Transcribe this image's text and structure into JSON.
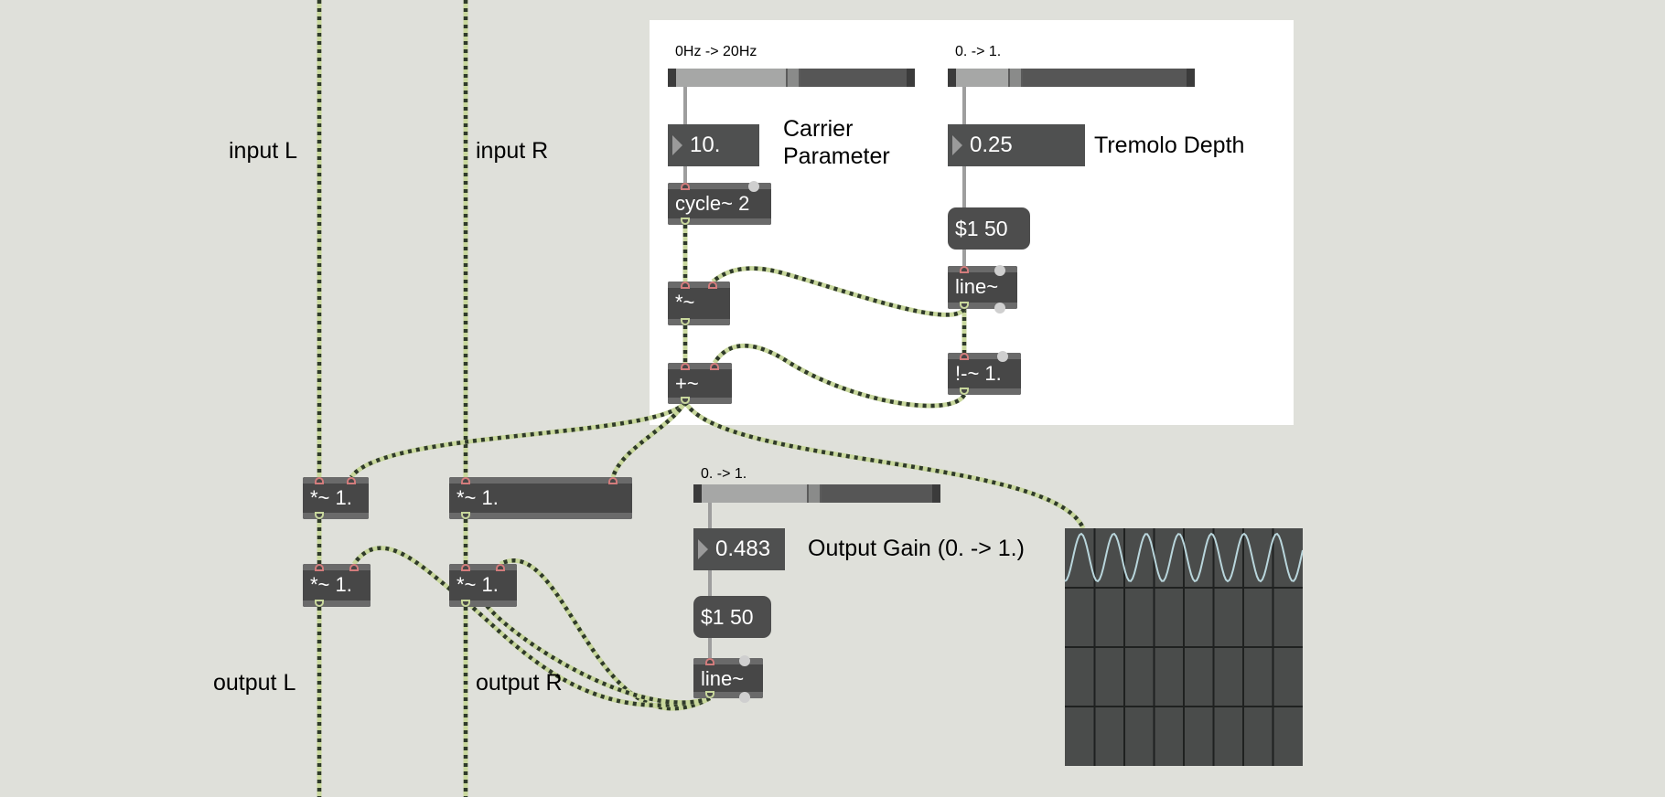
{
  "signals": {
    "input_l": "input L",
    "input_r": "input R",
    "output_l": "output L",
    "output_r": "output R"
  },
  "carrier": {
    "range_label": "0Hz -> 20Hz",
    "slider_fraction": 0.5,
    "number_value": "10.",
    "label": "Carrier\nParameter",
    "osc_object": "cycle~ 2"
  },
  "tremolo": {
    "range_label": "0. -> 1.",
    "slider_fraction": 0.25,
    "number_value": "0.25",
    "label": "Tremolo Depth",
    "message": "$1 50",
    "line_object": "line~",
    "invert_object": "!-~ 1."
  },
  "math": {
    "mult_object": "*~",
    "add_object": "+~"
  },
  "gain_stage": {
    "left_mod": "*~ 1.",
    "right_mod": "*~ 1.",
    "left_out": "*~ 1.",
    "right_out": "*~ 1."
  },
  "output": {
    "range_label": "0. -> 1.",
    "slider_fraction": 0.483,
    "number_value": "0.483",
    "label": "Output Gain (0. -> 1.)",
    "message": "$1 50",
    "line_object": "line~"
  },
  "colors": {
    "patch_bg": "#dfe0da",
    "panel_bg": "#ffffff",
    "object_bg": "#474747",
    "signal_cord": "#c8d79c",
    "scope_trace": "#b9d6dc"
  }
}
